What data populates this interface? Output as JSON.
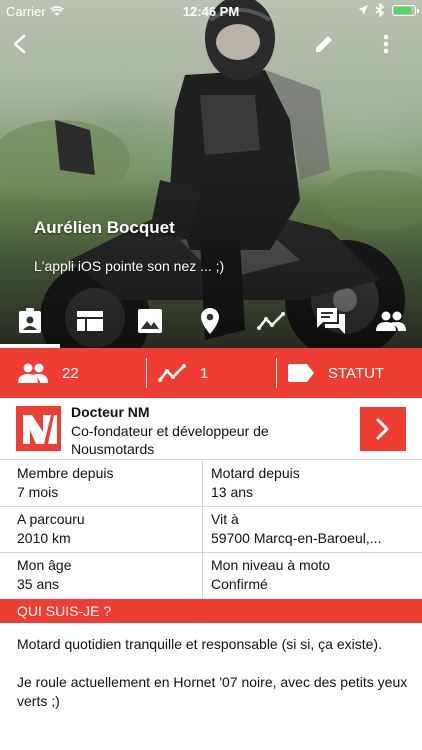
{
  "status_bar": {
    "carrier": "Carrier",
    "time": "12:46 PM"
  },
  "profile": {
    "name": "Aurélien Bocquet",
    "tagline": "L'appli iOS pointe son nez ... ;)"
  },
  "tabs": [
    {
      "icon": "profile-badge-icon",
      "active": true
    },
    {
      "icon": "dashboard-icon",
      "active": false
    },
    {
      "icon": "photo-icon",
      "active": false
    },
    {
      "icon": "location-pin-icon",
      "active": false
    },
    {
      "icon": "route-icon",
      "active": false
    },
    {
      "icon": "chat-icon",
      "active": false
    },
    {
      "icon": "group-icon",
      "active": false
    }
  ],
  "stats": {
    "friends_count": "22",
    "rides_count": "1",
    "status_label": "STATUT"
  },
  "company": {
    "logo_text": "N",
    "name": "Docteur NM",
    "role": "Co-fondateur et développeur de Nousmotards"
  },
  "info": {
    "member_since_label": "Membre depuis",
    "member_since_value": "7 mois",
    "rider_since_label": "Motard depuis",
    "rider_since_value": "13 ans",
    "distance_label": "A parcouru",
    "distance_value": "2010 km",
    "lives_label": "Vit à",
    "lives_value": "59700 Marcq-en-Baroeul,...",
    "age_label": "Mon âge",
    "age_value": "35 ans",
    "level_label": "Mon niveau à moto",
    "level_value": "Confirmé"
  },
  "about": {
    "header": "QUI SUIS-JE ?",
    "paragraph_1": "Motard quotidien tranquille et responsable (si si, ça existe).",
    "paragraph_2": "Je roule actuellement en Hornet '07 noire, avec des petits yeux verts ;)"
  },
  "colors": {
    "accent": "#ee3e34",
    "text": "#111111",
    "divider": "#d6d6d6"
  }
}
